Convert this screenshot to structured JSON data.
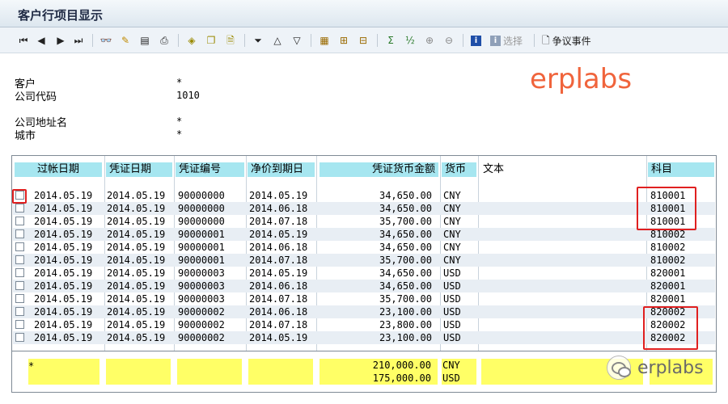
{
  "window": {
    "title": "客户行项目显示"
  },
  "toolbar": {
    "select_label": "选择",
    "dispute_label": "争议事件"
  },
  "header": {
    "fields": [
      {
        "label": "客户",
        "value": "*"
      },
      {
        "label": "公司代码",
        "value": "1010"
      },
      {
        "label": "公司地址名",
        "value": "*"
      },
      {
        "label": "城市",
        "value": "*"
      }
    ]
  },
  "watermark": "erplabs",
  "table": {
    "columns": [
      "过帐日期",
      "凭证日期",
      "凭证编号",
      "净价到期日",
      "凭证货币金额",
      "货币",
      "文本",
      "科目"
    ],
    "rows": [
      [
        "2014.05.19",
        "2014.05.19",
        "90000000",
        "2014.05.19",
        "34,650.00",
        "CNY",
        "",
        "810001"
      ],
      [
        "2014.05.19",
        "2014.05.19",
        "90000000",
        "2014.06.18",
        "34,650.00",
        "CNY",
        "",
        "810001"
      ],
      [
        "2014.05.19",
        "2014.05.19",
        "90000000",
        "2014.07.18",
        "35,700.00",
        "CNY",
        "",
        "810001"
      ],
      [
        "2014.05.19",
        "2014.05.19",
        "90000001",
        "2014.05.19",
        "34,650.00",
        "CNY",
        "",
        "810002"
      ],
      [
        "2014.05.19",
        "2014.05.19",
        "90000001",
        "2014.06.18",
        "34,650.00",
        "CNY",
        "",
        "810002"
      ],
      [
        "2014.05.19",
        "2014.05.19",
        "90000001",
        "2014.07.18",
        "35,700.00",
        "CNY",
        "",
        "810002"
      ],
      [
        "2014.05.19",
        "2014.05.19",
        "90000003",
        "2014.05.19",
        "34,650.00",
        "USD",
        "",
        "820001"
      ],
      [
        "2014.05.19",
        "2014.05.19",
        "90000003",
        "2014.06.18",
        "34,650.00",
        "USD",
        "",
        "820001"
      ],
      [
        "2014.05.19",
        "2014.05.19",
        "90000003",
        "2014.07.18",
        "35,700.00",
        "USD",
        "",
        "820001"
      ],
      [
        "2014.05.19",
        "2014.05.19",
        "90000002",
        "2014.06.18",
        "23,100.00",
        "USD",
        "",
        "820002"
      ],
      [
        "2014.05.19",
        "2014.05.19",
        "90000002",
        "2014.07.18",
        "23,800.00",
        "USD",
        "",
        "820002"
      ],
      [
        "2014.05.19",
        "2014.05.19",
        "90000002",
        "2014.05.19",
        "23,100.00",
        "USD",
        "",
        "820002"
      ]
    ],
    "totals": {
      "marker": "*",
      "lines": [
        {
          "amount": "210,000.00",
          "currency": "CNY"
        },
        {
          "amount": "175,000.00",
          "currency": "USD"
        }
      ]
    }
  },
  "footer_brand": "erplabs"
}
